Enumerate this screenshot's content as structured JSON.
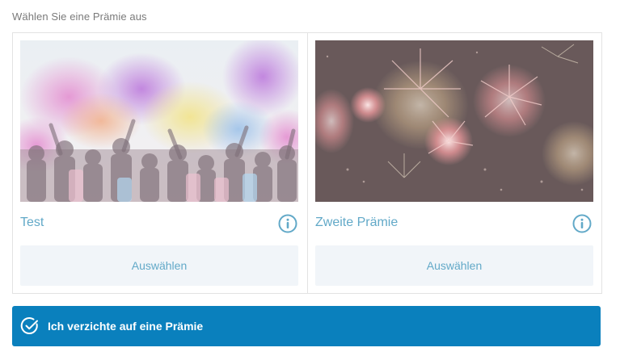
{
  "heading": "Wählen Sie eine Prämie aus",
  "rewards": [
    {
      "title": "Test",
      "image_subject": "holi color festival crowd",
      "select_label": "Auswählen",
      "info_icon": "info-circle-icon"
    },
    {
      "title": "Zweite Prämie",
      "image_subject": "fireworks night sky",
      "select_label": "Auswählen",
      "info_icon": "info-circle-icon"
    }
  ],
  "decline": {
    "label": "Ich verzichte auf eine Prämie",
    "icon": "check-circle-icon"
  },
  "colors": {
    "accent": "#62a9c8",
    "primary_button": "#0a80bd",
    "secondary_button_bg": "#f1f5f9",
    "heading_text": "#7a7a7a",
    "border": "#e3e3e3"
  }
}
